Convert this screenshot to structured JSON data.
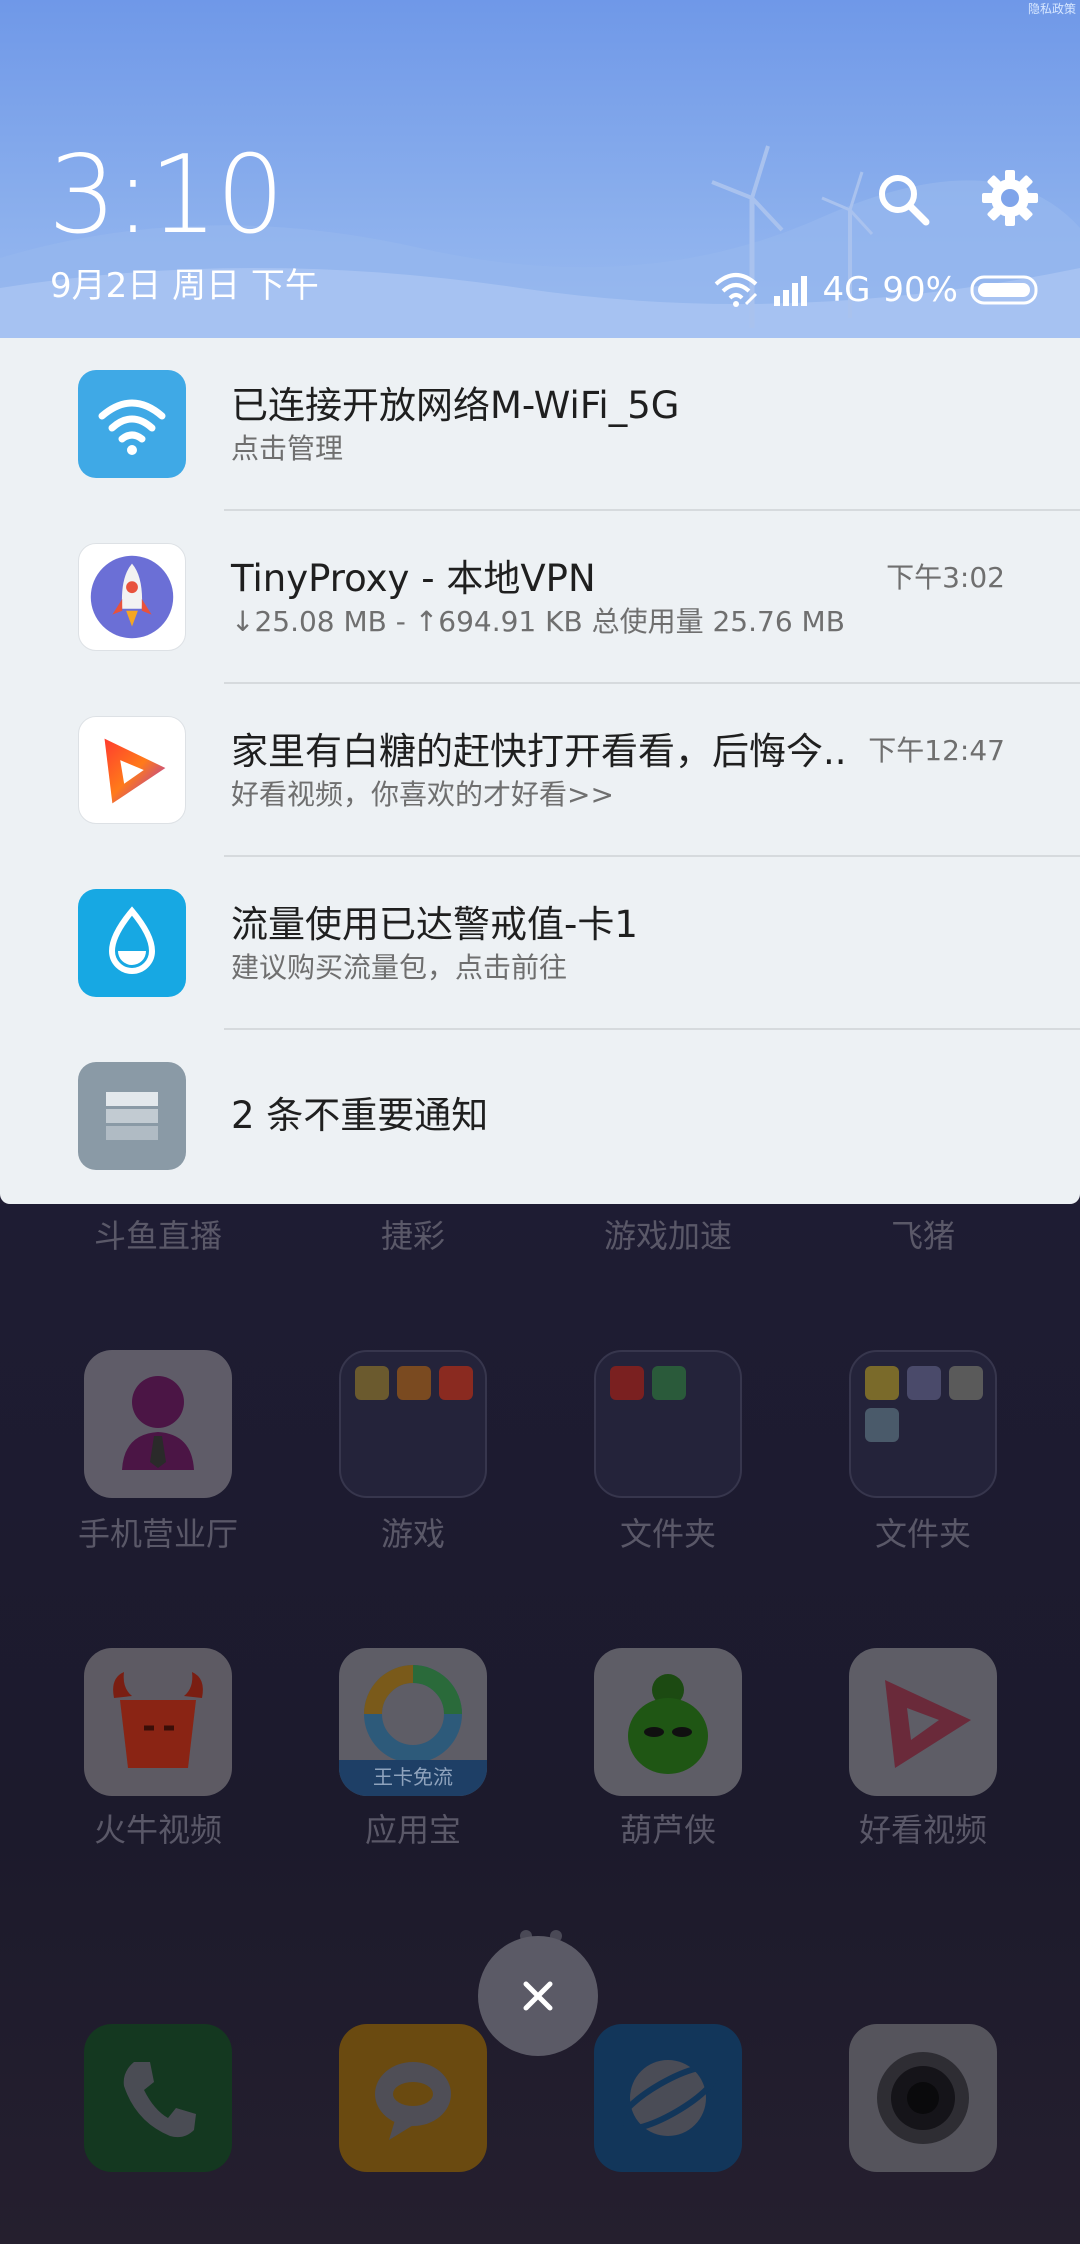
{
  "header": {
    "clock": "3:10",
    "date": "9月2日 周日 下午",
    "network_type": "4G",
    "battery_percent": "90%",
    "corner_text": "隐私政策"
  },
  "notifications": [
    {
      "icon": "wifi-icon",
      "icon_bg": "#3fa9e6",
      "title": "已连接开放网络M-WiFi_5G",
      "subtitle": "点击管理",
      "time": ""
    },
    {
      "icon": "rocket-icon",
      "icon_bg": "#ffffff",
      "title": "TinyProxy - 本地VPN",
      "subtitle": "↓25.08 MB - ↑694.91 KB 总使用量 25.76 MB",
      "time": "下午3:02"
    },
    {
      "icon": "play-icon",
      "icon_bg": "#ffffff",
      "title": "家里有白糖的赶快打开看看，后悔今..",
      "subtitle": "好看视频，你喜欢的才好看>>",
      "time": "下午12:47"
    },
    {
      "icon": "water-drop-icon",
      "icon_bg": "#17a8e3",
      "title": "流量使用已达警戒值-卡1",
      "subtitle": "建议购买流量包，点击前往",
      "time": ""
    },
    {
      "icon": "stack-icon",
      "icon_bg": "#8a9aa6",
      "title": "2 条不重要通知",
      "subtitle": "",
      "time": ""
    }
  ],
  "home": {
    "row0_labels": [
      "斗鱼直播",
      "捷彩",
      "游戏加速",
      "飞猪"
    ],
    "row1_labels": [
      "手机营业厅",
      "游戏",
      "文件夹",
      "文件夹"
    ],
    "row2_labels": [
      "火牛视频",
      "应用宝",
      "葫芦侠",
      "好看视频"
    ],
    "yingyongbao_badge": "王卡免流",
    "dock": [
      "phone-icon",
      "message-icon",
      "browser-icon",
      "camera-icon"
    ]
  },
  "colors": {
    "header_top": "#6f98e8",
    "panel_bg": "#edf1f4",
    "dim_bg": "#1e1c33"
  }
}
